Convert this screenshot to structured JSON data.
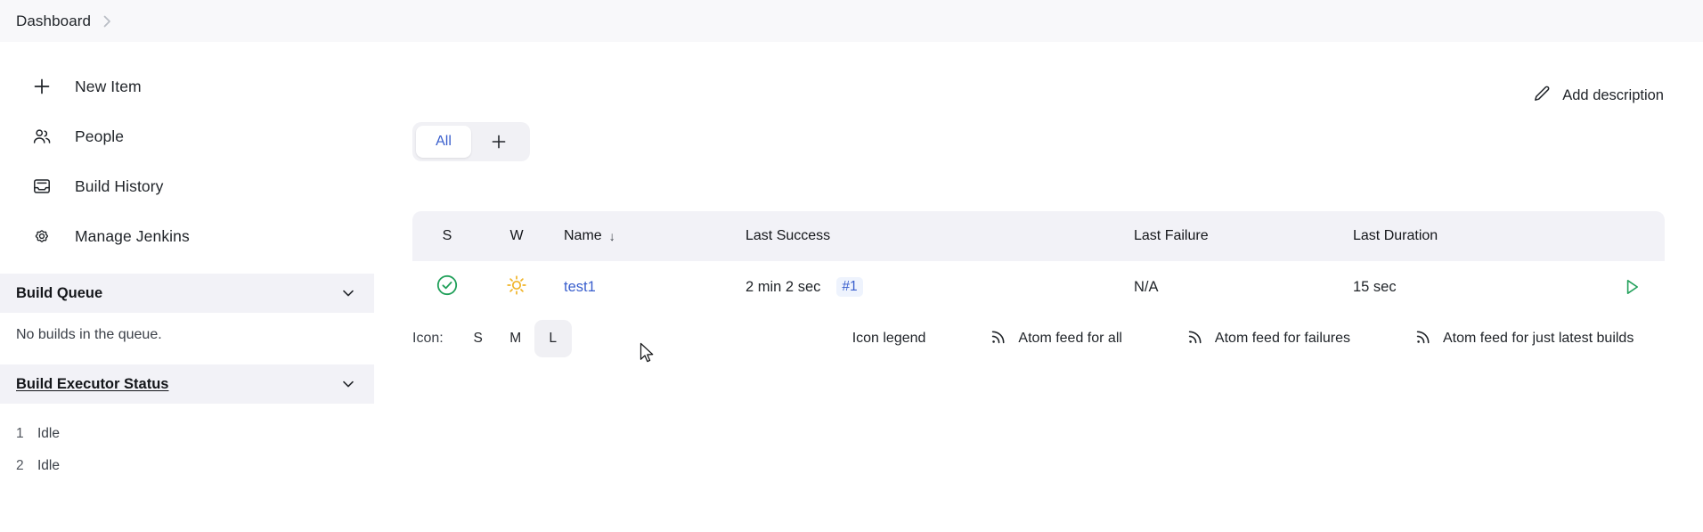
{
  "breadcrumb": {
    "items": [
      "Dashboard"
    ],
    "separator": "›"
  },
  "sidebar": {
    "nav": [
      {
        "label": "New Item",
        "icon": "plus-icon"
      },
      {
        "label": "People",
        "icon": "people-icon"
      },
      {
        "label": "Build History",
        "icon": "inbox-icon"
      },
      {
        "label": "Manage Jenkins",
        "icon": "gear-icon"
      }
    ],
    "build_queue": {
      "title": "Build Queue",
      "empty_message": "No builds in the queue.",
      "chevron": "chevron-down-icon"
    },
    "build_executor_status": {
      "title": "Build Executor Status",
      "chevron": "chevron-down-icon",
      "executors": [
        {
          "number": "1",
          "state": "Idle"
        },
        {
          "number": "2",
          "state": "Idle"
        }
      ]
    }
  },
  "main": {
    "add_description": {
      "label": "Add description",
      "icon": "pencil-icon"
    },
    "tabs": {
      "items": [
        {
          "label": "All",
          "active": true
        }
      ],
      "add_label": "+",
      "add_icon": "plus-icon"
    },
    "table": {
      "columns": [
        "S",
        "W",
        "Name",
        "Last Success",
        "Last Failure",
        "Last Duration",
        ""
      ],
      "sort_column": "Name",
      "sort_indicator": "↓",
      "rows": [
        {
          "status_icon": "success-check-icon",
          "weather_icon": "sunny-icon",
          "name": "test1",
          "last_success": "2 min 2 sec",
          "last_success_build": "#1",
          "last_failure": "N/A",
          "last_duration": "15 sec",
          "build_action_icon": "play-icon"
        }
      ]
    },
    "footer": {
      "icon_label": "Icon:",
      "icon_sizes": [
        {
          "label": "S",
          "selected": false
        },
        {
          "label": "M",
          "selected": false
        },
        {
          "label": "L",
          "selected": true
        }
      ],
      "links": [
        {
          "label": "Icon legend",
          "icon": null
        },
        {
          "label": "Atom feed for all",
          "icon": "rss-icon"
        },
        {
          "label": "Atom feed for failures",
          "icon": "rss-icon"
        },
        {
          "label": "Atom feed for just latest builds",
          "icon": "rss-icon"
        }
      ]
    }
  },
  "colors": {
    "link": "#3a5fcd",
    "success": "#21a05a",
    "weather_sunny": "#f0b429",
    "header_bg": "#f2f2f7",
    "breadcrumb_bg": "#f8f8fa"
  }
}
